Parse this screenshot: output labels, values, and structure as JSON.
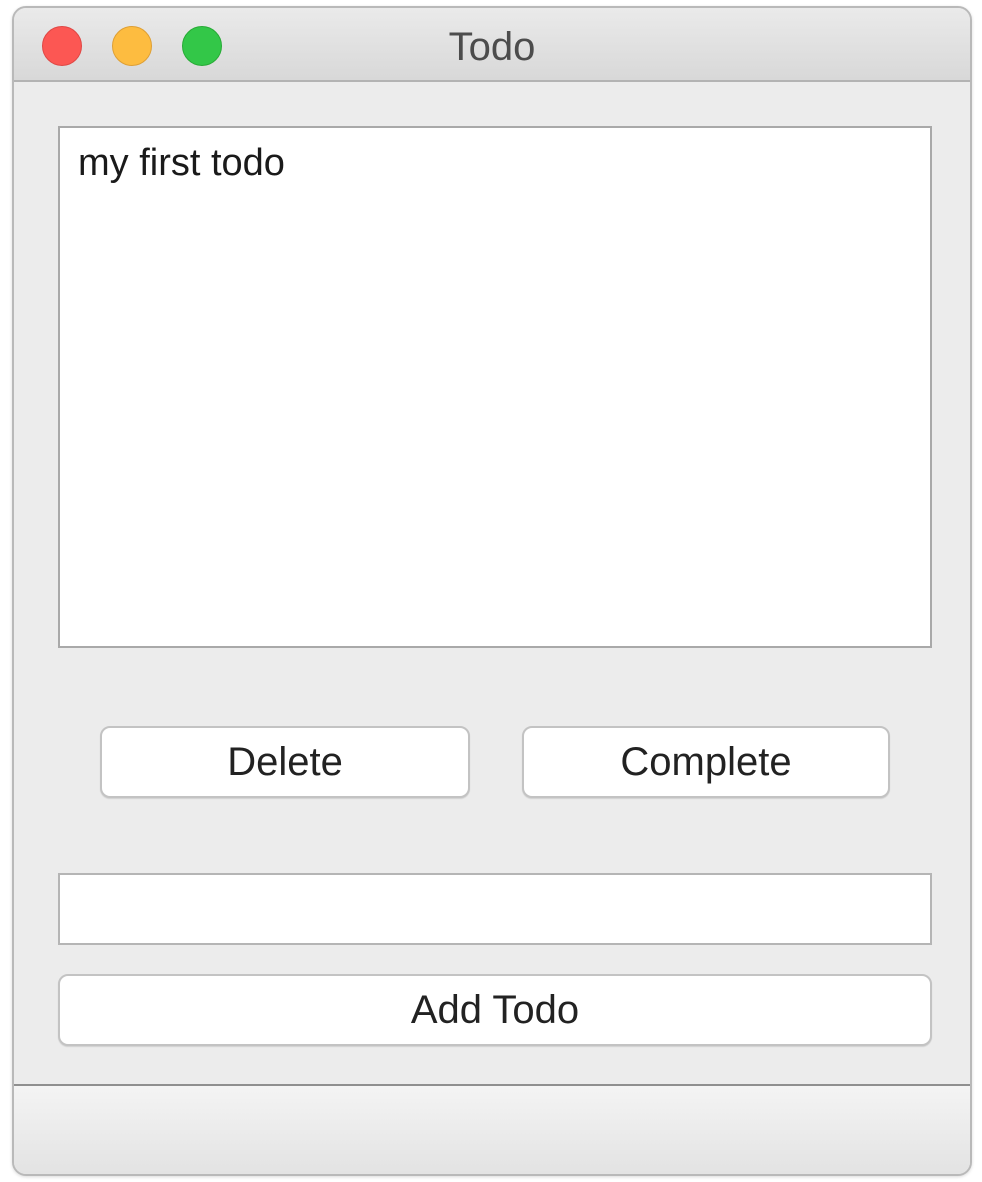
{
  "window": {
    "title": "Todo"
  },
  "todo_list": {
    "items": [
      {
        "label": "my first todo"
      }
    ]
  },
  "actions": {
    "delete_label": "Delete",
    "complete_label": "Complete"
  },
  "new_todo": {
    "value": "",
    "placeholder": ""
  },
  "add": {
    "label": "Add Todo"
  },
  "colors": {
    "close": "#fc5753",
    "minimize": "#fdbc40",
    "zoom": "#33c748"
  }
}
